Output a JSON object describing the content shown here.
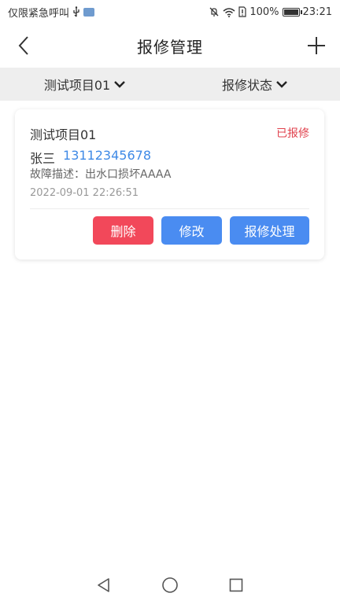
{
  "status_bar": {
    "left_text": "仅限紧急呼叫",
    "icons_left": [
      "usb-icon",
      "sim-card-icon"
    ],
    "icons_right": [
      "mute-icon",
      "wifi-icon",
      "sim-alert-icon",
      "battery-icon"
    ],
    "battery": "100%",
    "time": "23:21"
  },
  "header": {
    "title": "报修管理"
  },
  "filters": {
    "project": "测试项目01",
    "status": "报修状态"
  },
  "records": [
    {
      "project": "测试项目01",
      "status": "已报修",
      "name": "张三",
      "phone": "13112345678",
      "desc_label": "故障描述：",
      "desc": "出水口损坏AAAA",
      "time": "2022-09-01 22:26:51",
      "actions": {
        "delete": "删除",
        "edit": "修改",
        "process": "报修处理"
      }
    }
  ],
  "colors": {
    "status_red": "#e0424d",
    "phone_blue": "#3f8ae6",
    "delete_button": "#f2485a",
    "primary_button": "#4a8cf1",
    "filter_bar_bg": "#eeeeee"
  }
}
